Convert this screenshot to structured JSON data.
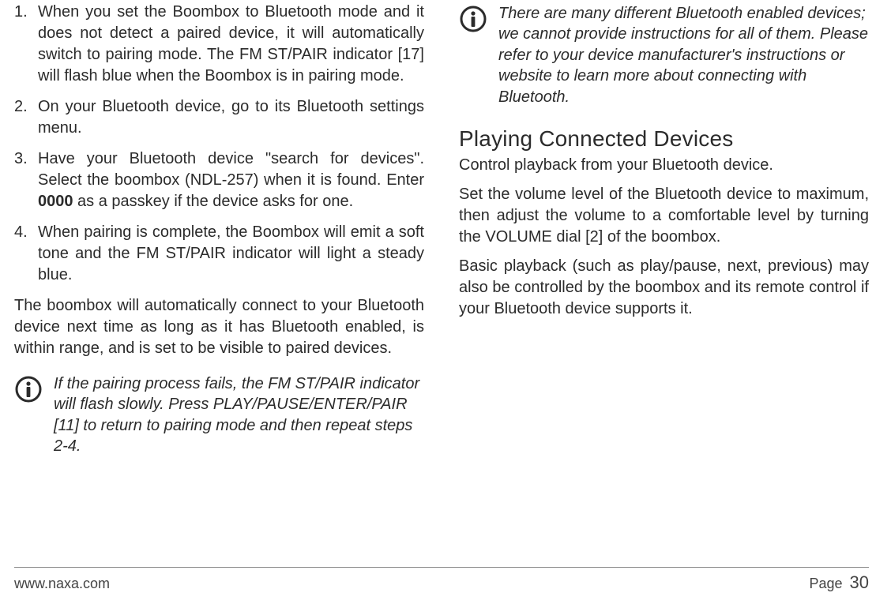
{
  "col1": {
    "steps": [
      {
        "pre": "When you set the Boombox to Bluetooth mode and it does not detect a paired device, it will automatically switch to pairing mode. The FM ST/PAIR indicator [17] will flash blue when the Boombox is in pairing mode."
      },
      {
        "pre": "On your Bluetooth device, go to its Bluetooth settings menu."
      },
      {
        "pre": "Have your Bluetooth device \"search for devices\". Select the boombox (NDL-257) when it is found. Enter ",
        "bold": "0000",
        "post": " as a passkey if the device asks for one."
      },
      {
        "pre": "When pairing is complete, the Boombox will emit a soft tone and the FM ST/PAIR indicator will light a steady blue."
      }
    ],
    "autoText": "The boombox will automatically connect to your Bluetooth device next time as long as it has Bluetooth enabled, is within range, and is set to be visible to paired devices.",
    "note1": "If the pairing process fails, the FM ST/PAIR indicator will flash slowly. Press PLAY/PAUSE/ENTER/PAIR [11] to return to pairing mode and then repeat steps 2-4."
  },
  "col2": {
    "note2": "There are many different Bluetooth enabled devices; we cannot provide instructions for all of them. Please refer to your device manufacturer's instructions or website to learn more about connecting with Bluetooth.",
    "heading": "Playing Connected Devices",
    "p1": "Control playback from your Bluetooth device.",
    "p2": "Set the volume level of the Bluetooth device to maximum, then adjust the volume to a comfortable level by turning the VOLUME dial [2] of the boombox.",
    "p3": "Basic playback (such as play/pause, next, previous) may also be controlled by the boombox and its remote control if your Bluetooth device supports it."
  },
  "footer": {
    "url": "www.naxa.com",
    "pageLabel": "Page",
    "pageNum": "30"
  }
}
